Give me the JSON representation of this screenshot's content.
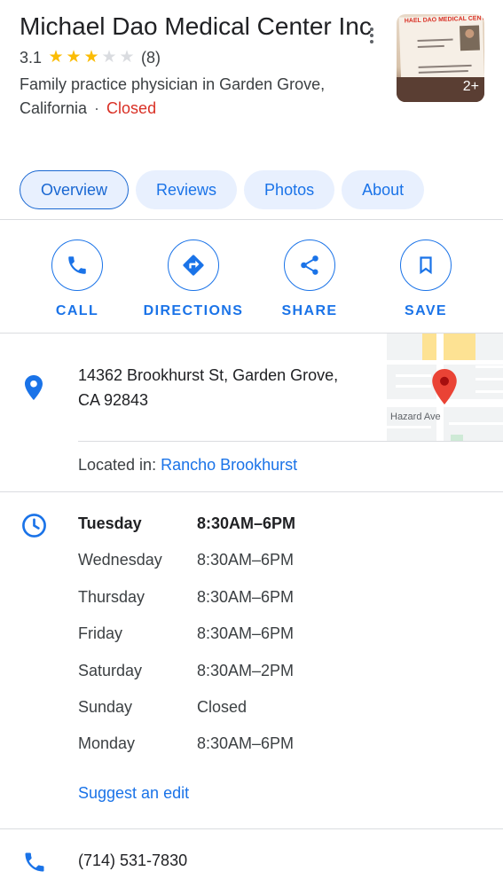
{
  "place": {
    "name": "Michael Dao Medical Center Inc",
    "rating": "3.1",
    "rating_value": 3.1,
    "review_count": "(8)",
    "category": "Family practice physician in Garden Grove, California",
    "separator": "·",
    "status": "Closed",
    "photo_count": "2+",
    "photo_card_text": "HAEL DAO MEDICAL CENTER"
  },
  "tabs": [
    {
      "label": "Overview",
      "active": true
    },
    {
      "label": "Reviews",
      "active": false
    },
    {
      "label": "Photos",
      "active": false
    },
    {
      "label": "About",
      "active": false
    }
  ],
  "actions": [
    {
      "label": "CALL",
      "icon": "phone-icon"
    },
    {
      "label": "DIRECTIONS",
      "icon": "directions-icon"
    },
    {
      "label": "SHARE",
      "icon": "share-icon"
    },
    {
      "label": "SAVE",
      "icon": "bookmark-icon"
    }
  ],
  "address": {
    "line1": "14362 Brookhurst St, Garden Grove,",
    "line2": "CA 92843",
    "map_street": "Hazard Ave",
    "located_prefix": "Located in:",
    "located_link": "Rancho Brookhurst"
  },
  "hours": [
    {
      "day": "Tuesday",
      "time": "8:30AM–6PM",
      "today": true
    },
    {
      "day": "Wednesday",
      "time": "8:30AM–6PM",
      "today": false
    },
    {
      "day": "Thursday",
      "time": "8:30AM–6PM",
      "today": false
    },
    {
      "day": "Friday",
      "time": "8:30AM–6PM",
      "today": false
    },
    {
      "day": "Saturday",
      "time": "8:30AM–2PM",
      "today": false
    },
    {
      "day": "Sunday",
      "time": "Closed",
      "today": false
    },
    {
      "day": "Monday",
      "time": "8:30AM–6PM",
      "today": false
    }
  ],
  "suggest_edit": "Suggest an edit",
  "phone": "(714) 531-7830",
  "colors": {
    "accent": "#1a73e8",
    "closed": "#d93025",
    "star": "#fbbc04",
    "pin": "#ea4335"
  }
}
